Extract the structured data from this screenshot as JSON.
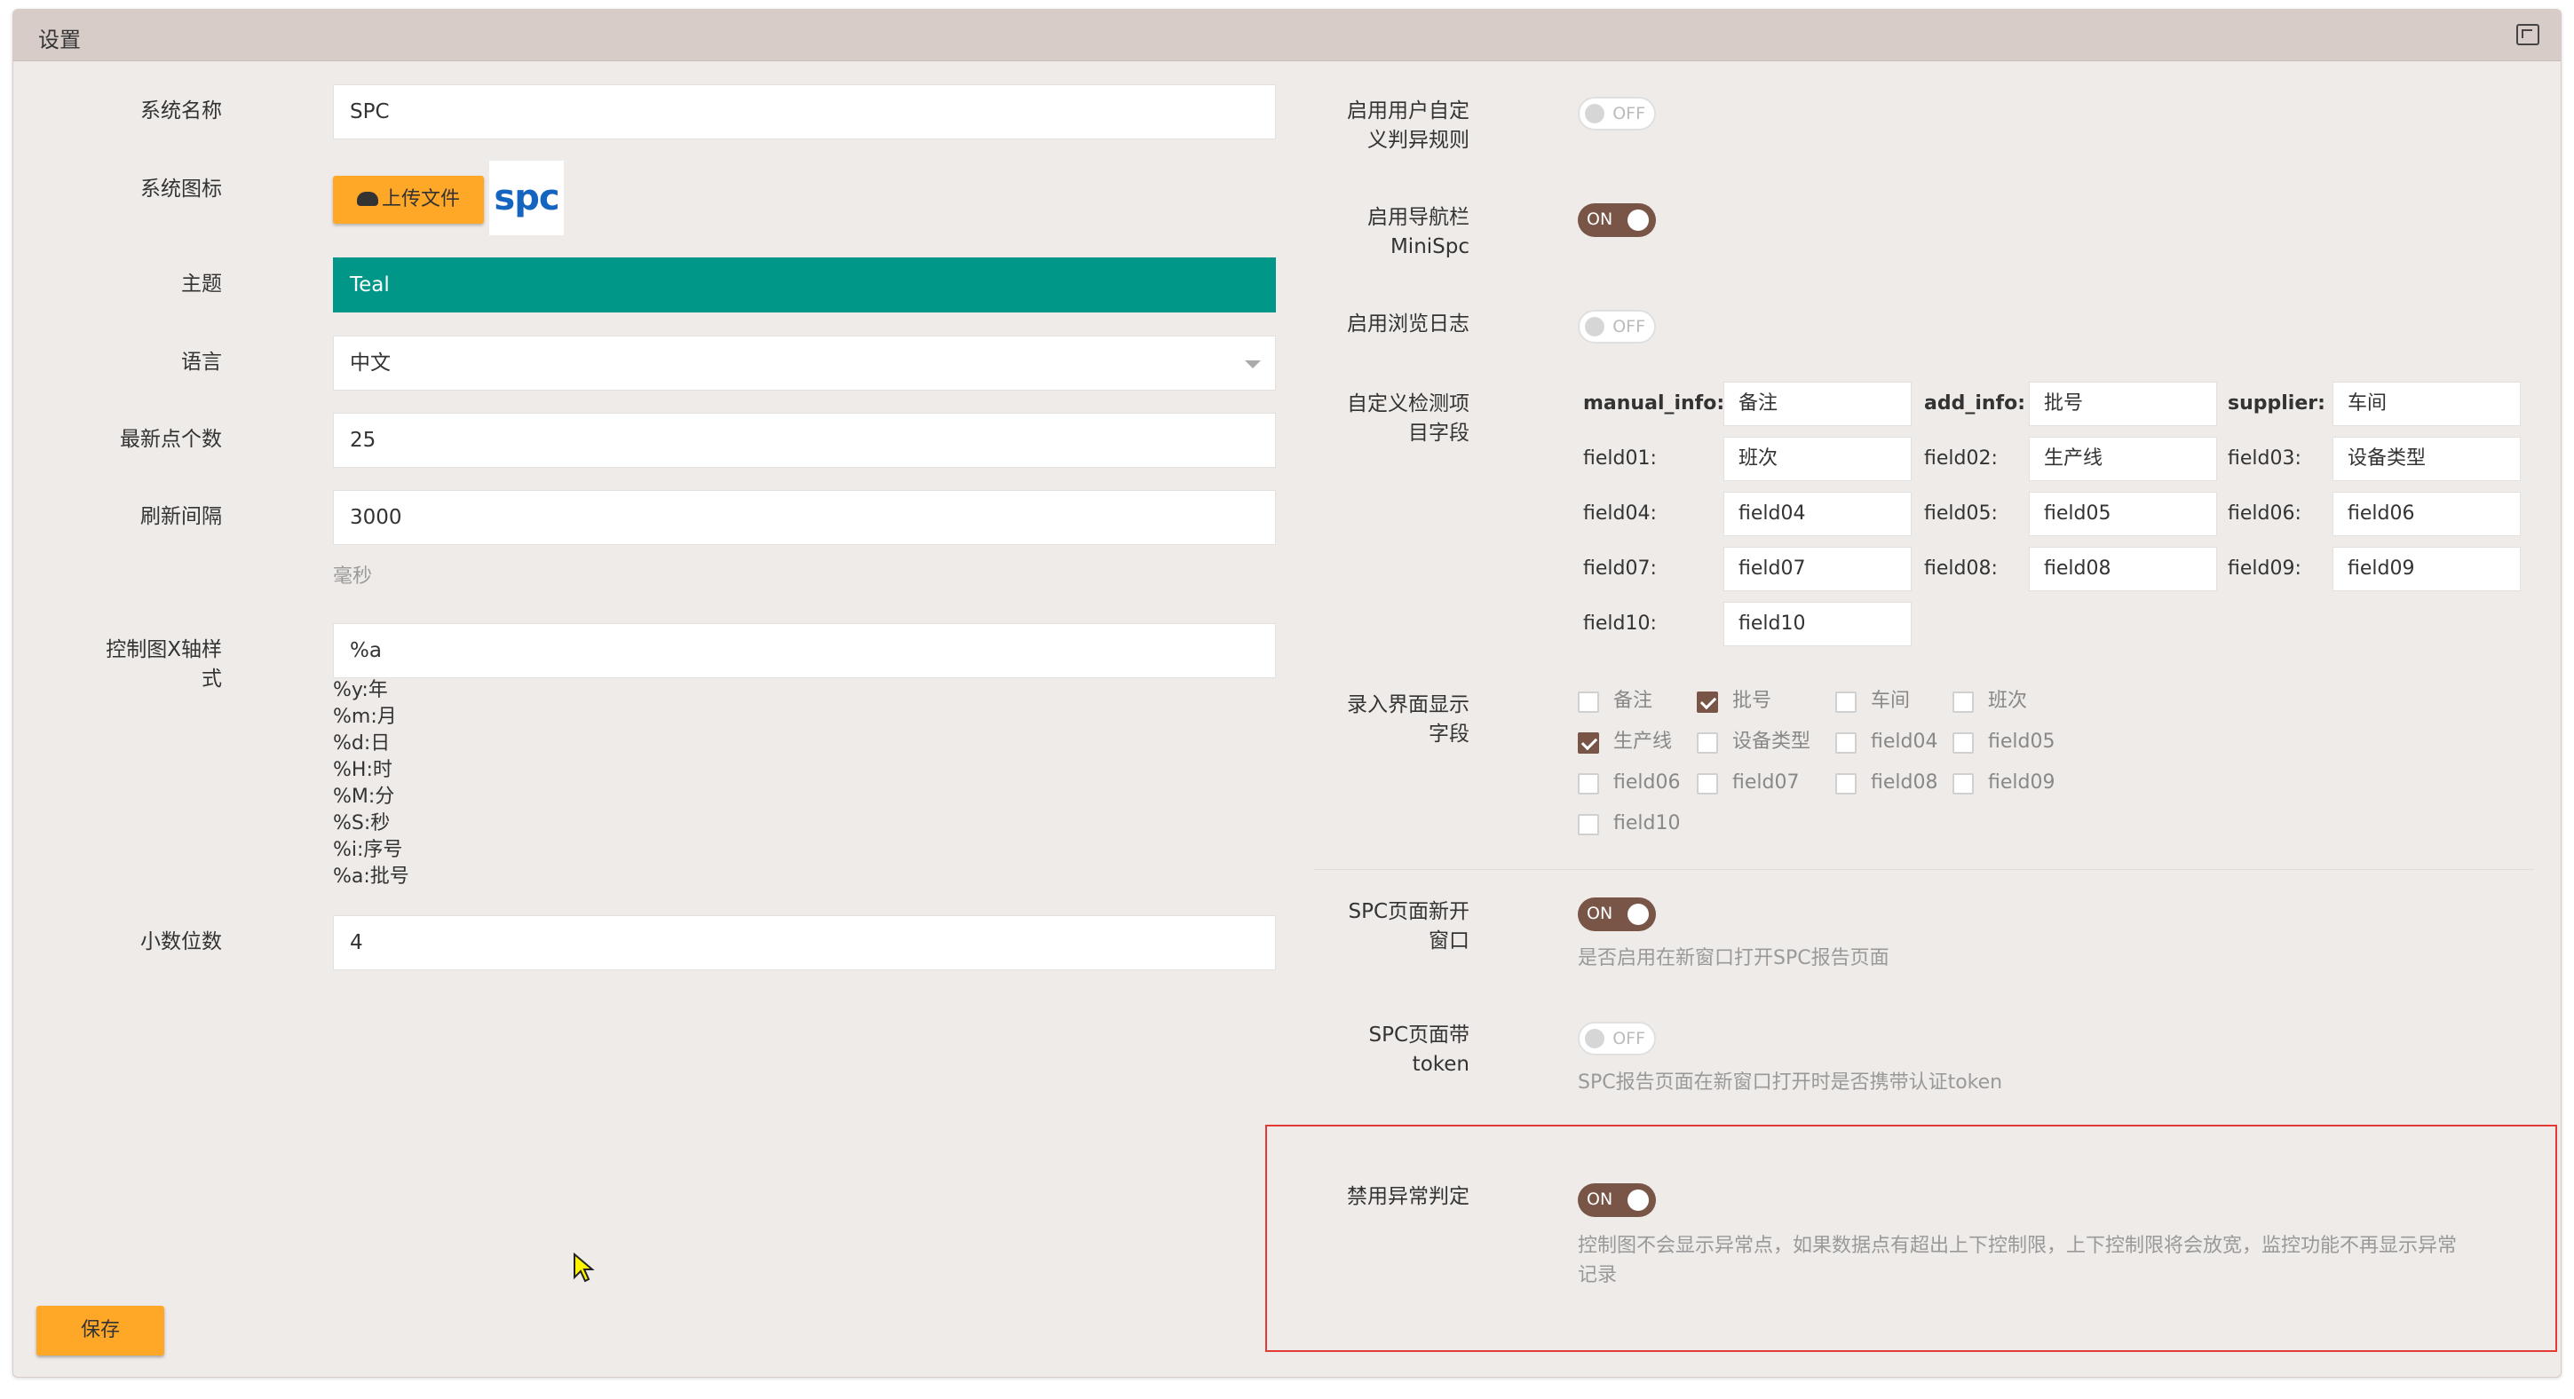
{
  "window": {
    "title": "设置"
  },
  "left": {
    "system_name": {
      "label": "系统名称",
      "value": "SPC"
    },
    "system_icon": {
      "label": "系统图标",
      "upload_label": "上传文件",
      "logo_text": "spc"
    },
    "theme": {
      "label": "主题",
      "value": "Teal",
      "color": "#009688"
    },
    "language": {
      "label": "语言",
      "value": "中文"
    },
    "latest_points": {
      "label": "最新点个数",
      "value": "25"
    },
    "refresh_interval": {
      "label": "刷新间隔",
      "value": "3000",
      "unit": "毫秒"
    },
    "xaxis_format": {
      "label_line1": "控制图X轴样",
      "label_line2": "式",
      "value": "%a",
      "formats": [
        "%y:年",
        "%m:月",
        "%d:日",
        "%H:时",
        "%M:分",
        "%S:秒",
        "%i:序号",
        "%a:批号"
      ]
    },
    "decimals": {
      "label": "小数位数",
      "value": "4"
    },
    "save_label": "保存"
  },
  "right": {
    "custom_rules": {
      "label_line1": "启用用户自定",
      "label_line2": "义判异规则",
      "state": "OFF"
    },
    "navbar": {
      "label_line1": "启用导航栏",
      "label_line2": "MiniSpc",
      "state": "ON"
    },
    "browse_log": {
      "label": "启用浏览日志",
      "state": "OFF"
    },
    "custom_fields": {
      "label_line1": "自定义检测项",
      "label_line2": "目字段",
      "rows": [
        [
          {
            "key": "manual_info:",
            "value": "备注"
          },
          {
            "key": "add_info:",
            "value": "批号"
          },
          {
            "key": "supplier:",
            "value": "车间"
          }
        ],
        [
          {
            "key": "field01:",
            "value": "班次"
          },
          {
            "key": "field02:",
            "value": "生产线"
          },
          {
            "key": "field03:",
            "value": "设备类型"
          }
        ],
        [
          {
            "key": "field04:",
            "value": "field04"
          },
          {
            "key": "field05:",
            "value": "field05"
          },
          {
            "key": "field06:",
            "value": "field06"
          }
        ],
        [
          {
            "key": "field07:",
            "value": "field07"
          },
          {
            "key": "field08:",
            "value": "field08"
          },
          {
            "key": "field09:",
            "value": "field09"
          }
        ],
        [
          {
            "key": "field10:",
            "value": "field10"
          }
        ]
      ]
    },
    "display_fields": {
      "label_line1": "录入界面显示",
      "label_line2": "字段",
      "items": [
        {
          "label": "备注",
          "checked": false
        },
        {
          "label": "批号",
          "checked": true
        },
        {
          "label": "车间",
          "checked": false
        },
        {
          "label": "班次",
          "checked": false
        },
        {
          "label": "生产线",
          "checked": true
        },
        {
          "label": "设备类型",
          "checked": false
        },
        {
          "label": "field04",
          "checked": false
        },
        {
          "label": "field05",
          "checked": false
        },
        {
          "label": "field06",
          "checked": false
        },
        {
          "label": "field07",
          "checked": false
        },
        {
          "label": "field08",
          "checked": false
        },
        {
          "label": "field09",
          "checked": false
        },
        {
          "label": "field10",
          "checked": false
        }
      ]
    },
    "spc_new_window": {
      "label_line1": "SPC页面新开",
      "label_line2": "窗口",
      "state": "ON",
      "desc": "是否启用在新窗口打开SPC报告页面"
    },
    "spc_token": {
      "label_line1": "SPC页面带",
      "label_line2": "token",
      "state": "OFF",
      "desc": "SPC报告页面在新窗口打开时是否携带认证token"
    },
    "disable_anomaly": {
      "label": "禁用异常判定",
      "state": "ON",
      "desc_line1": "控制图不会显示异常点，如果数据点有超出上下控制限，上下控制限将会放宽，监控功能不再显示异常",
      "desc_line2": "记录"
    }
  },
  "colors": {
    "accent": "#795548",
    "button": "#ffa726",
    "panel_bg": "#efebe9",
    "header_bg": "#d7ccc8",
    "highlight_border": "#e53935"
  }
}
